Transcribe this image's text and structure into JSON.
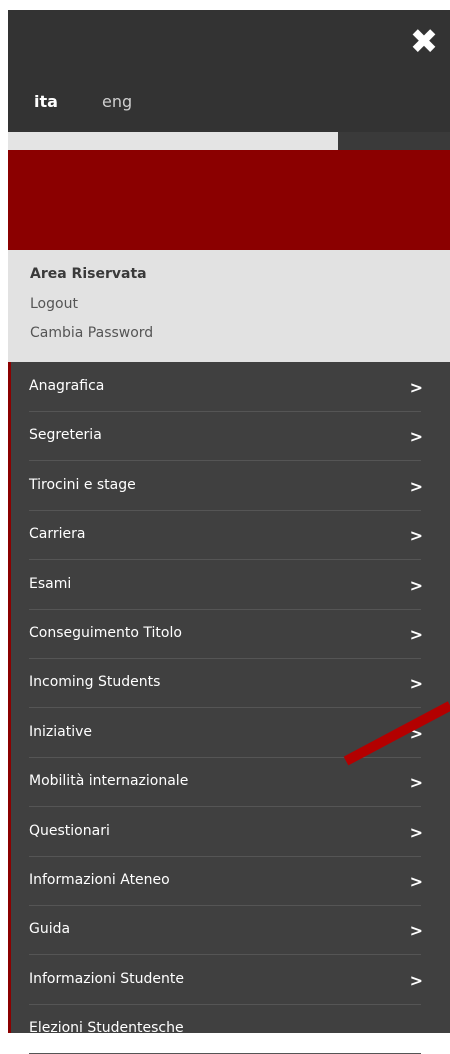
{
  "header": {
    "close_icon": "close-icon",
    "languages": [
      "ita",
      "eng"
    ],
    "active_language": "ita"
  },
  "reserved_area": {
    "title": "Area Riservata",
    "logout": "Logout",
    "change_password": "Cambia Password"
  },
  "menu": {
    "items": [
      {
        "label": "Anagrafica",
        "chevron": true
      },
      {
        "label": "Segreteria",
        "chevron": true
      },
      {
        "label": "Tirocini e stage",
        "chevron": true
      },
      {
        "label": "Carriera",
        "chevron": true
      },
      {
        "label": "Esami",
        "chevron": true
      },
      {
        "label": "Conseguimento Titolo",
        "chevron": true
      },
      {
        "label": "Incoming Students",
        "chevron": true
      },
      {
        "label": "Iniziative",
        "chevron": true
      },
      {
        "label": "Mobilità internazionale",
        "chevron": true
      },
      {
        "label": "Questionari",
        "chevron": true
      },
      {
        "label": "Informazioni Ateneo",
        "chevron": true
      },
      {
        "label": "Guida",
        "chevron": true
      },
      {
        "label": "Informazioni Studente",
        "chevron": true
      },
      {
        "label": "Elezioni Studentesche",
        "chevron": false
      }
    ],
    "chevron_glyph": ">"
  },
  "colors": {
    "brand_red": "#8b0000",
    "menu_bg": "#404040",
    "header_bg": "#333333"
  }
}
